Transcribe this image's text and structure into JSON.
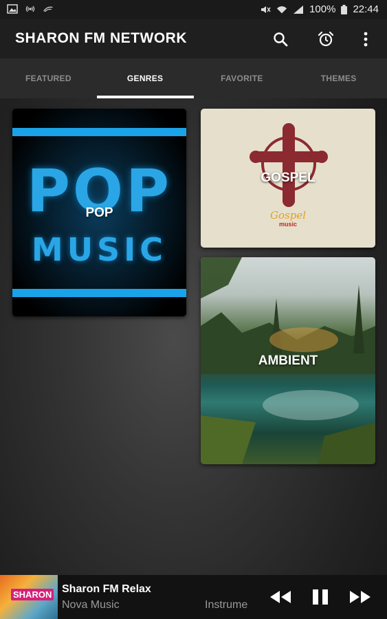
{
  "status_bar": {
    "battery": "100%",
    "time": "22:44"
  },
  "app_bar": {
    "title": "SHARON FM NETWORK",
    "icons": [
      "search-icon",
      "alarm-icon",
      "more-vert-icon"
    ]
  },
  "tabs": [
    {
      "label": "FEATURED",
      "active": false
    },
    {
      "label": "GENRES",
      "active": true
    },
    {
      "label": "FAVORITE",
      "active": false
    },
    {
      "label": "THEMES",
      "active": false
    }
  ],
  "genres": [
    {
      "label": "POP",
      "art_title": "POP",
      "art_subtitle": "MUSIC"
    },
    {
      "label": "GOSPEL",
      "art_caption": "Gospel",
      "art_caption_sub": "music"
    },
    {
      "label": "AMBIENT"
    }
  ],
  "player": {
    "thumb_logo": "SHARON",
    "title": "Sharon FM Relax",
    "subtitle": "Nova Music",
    "genre": "Instrume",
    "controls": [
      "rewind-icon",
      "pause-icon",
      "fast-forward-icon"
    ]
  },
  "colors": {
    "app_bar": "#1f1f1f",
    "tab_bar": "#2b2b2b",
    "tab_indicator": "#ffffff",
    "pop_accent": "#1aa3e8",
    "gospel_cross": "#8b2a30",
    "gospel_caption": "#e0a020"
  }
}
